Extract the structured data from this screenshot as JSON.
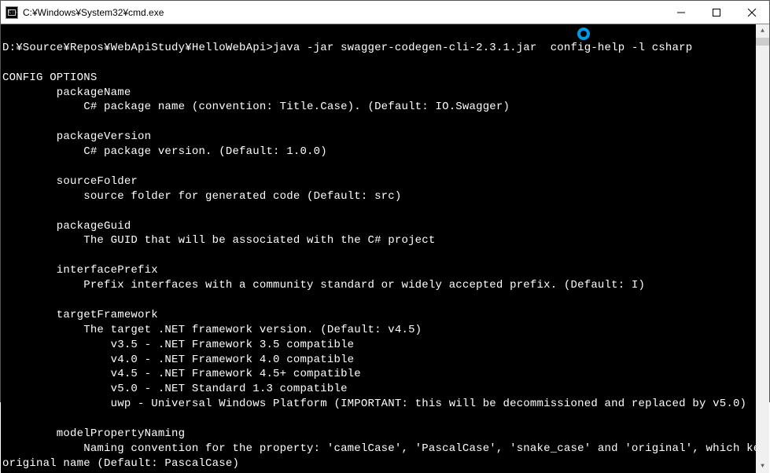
{
  "titlebar": {
    "title": "C:¥Windows¥System32¥cmd.exe",
    "icon_label": "cmd-icon"
  },
  "terminal": {
    "prompt_path": "D:¥Source¥Repos¥WebApiStudy¥HelloWebApi>",
    "command": "java -jar swagger-codegen-cli-2.3.1.jar  config-help -l csharp",
    "header": "CONFIG OPTIONS",
    "options": [
      {
        "name": "packageName",
        "desc": "C# package name (convention: Title.Case). (Default: IO.Swagger)"
      },
      {
        "name": "packageVersion",
        "desc": "C# package version. (Default: 1.0.0)"
      },
      {
        "name": "sourceFolder",
        "desc": "source folder for generated code (Default: src)"
      },
      {
        "name": "packageGuid",
        "desc": "The GUID that will be associated with the C# project"
      },
      {
        "name": "interfacePrefix",
        "desc": "Prefix interfaces with a community standard or widely accepted prefix. (Default: I)"
      }
    ],
    "targetFramework": {
      "name": "targetFramework",
      "desc": "The target .NET framework version. (Default: v4.5)",
      "values": [
        "v3.5 - .NET Framework 3.5 compatible",
        "v4.0 - .NET Framework 4.0 compatible",
        "v4.5 - .NET Framework 4.5+ compatible",
        "v5.0 - .NET Standard 1.3 compatible",
        "uwp - Universal Windows Platform (IMPORTANT: this will be decommissioned and replaced by v5.0)"
      ]
    },
    "modelPropertyNaming": {
      "name": "modelPropertyNaming",
      "desc_line1": "Naming convention for the property: 'camelCase', 'PascalCase', 'snake_case' and 'original', which keeps the",
      "desc_line2": "original name (Default: PascalCase)"
    }
  }
}
